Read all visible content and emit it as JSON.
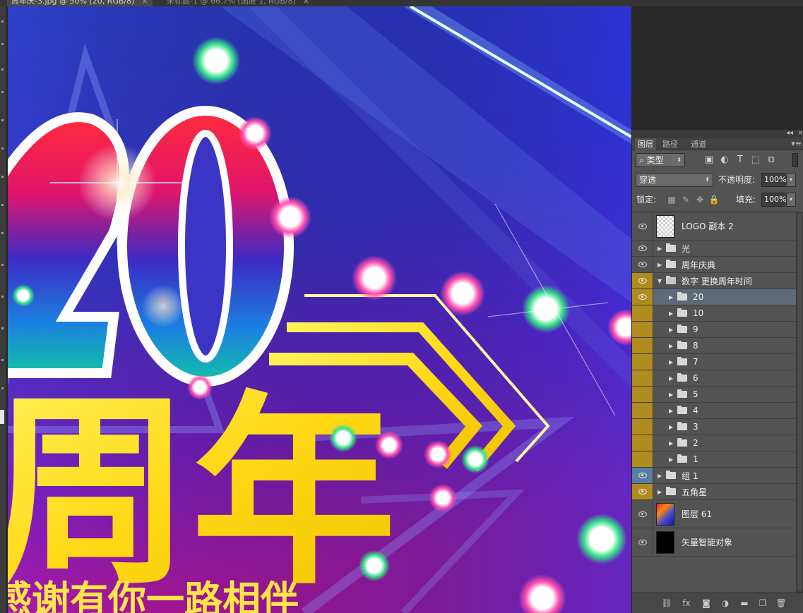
{
  "document_tabs": [
    {
      "label": "周年庆-3.jpg @ 50% (20, RGB/8)",
      "close": "×"
    },
    {
      "label": "未标题-1 @ 66.7% (图层 1, RGB/8)",
      "close": "×"
    }
  ],
  "canvas": {
    "big_number": "20",
    "headline": "周年",
    "subline": "感谢有你一路相伴"
  },
  "panel": {
    "collapse_glyph": "◂◂",
    "close_glyph": "×",
    "tabs": [
      "图层",
      "路径",
      "通道"
    ],
    "menu_glyph": "▾≡",
    "filter": {
      "kind_label": "类型",
      "search_glyph": "⌕"
    },
    "blend_mode": "穿透",
    "opacity_label": "不透明度:",
    "opacity_value": "100%",
    "lock_label": "锁定:",
    "fill_label": "填充:",
    "fill_value": "100%"
  },
  "layers": [
    {
      "name": "LOGO 副本 2",
      "type": "layer",
      "thumb": "checker",
      "eye": "normal",
      "indent": 0
    },
    {
      "name": "光",
      "type": "group",
      "expanded": false,
      "eye": "normal",
      "indent": 0
    },
    {
      "name": "周年庆典",
      "type": "group",
      "expanded": false,
      "eye": "normal",
      "indent": 0
    },
    {
      "name": "数字 更换周年时间",
      "type": "group",
      "expanded": true,
      "eye": "yellow",
      "indent": 0
    },
    {
      "name": "20",
      "type": "group",
      "expanded": false,
      "eye": "yellow",
      "indent": 1,
      "selected": true
    },
    {
      "name": "10",
      "type": "group",
      "expanded": false,
      "eye": "yellow-hidden",
      "indent": 1
    },
    {
      "name": "9",
      "type": "group",
      "expanded": false,
      "eye": "yellow-hidden",
      "indent": 1
    },
    {
      "name": "8",
      "type": "group",
      "expanded": false,
      "eye": "yellow-hidden",
      "indent": 1
    },
    {
      "name": "7",
      "type": "group",
      "expanded": false,
      "eye": "yellow-hidden",
      "indent": 1
    },
    {
      "name": "6",
      "type": "group",
      "expanded": false,
      "eye": "yellow-hidden",
      "indent": 1
    },
    {
      "name": "5",
      "type": "group",
      "expanded": false,
      "eye": "yellow-hidden",
      "indent": 1
    },
    {
      "name": "4",
      "type": "group",
      "expanded": false,
      "eye": "yellow-hidden",
      "indent": 1
    },
    {
      "name": "3",
      "type": "group",
      "expanded": false,
      "eye": "yellow-hidden",
      "indent": 1
    },
    {
      "name": "2",
      "type": "group",
      "expanded": false,
      "eye": "yellow-hidden",
      "indent": 1
    },
    {
      "name": "1",
      "type": "group",
      "expanded": false,
      "eye": "yellow-hidden",
      "indent": 1
    },
    {
      "name": "组 1",
      "type": "group",
      "expanded": false,
      "eye": "blue",
      "indent": 0
    },
    {
      "name": "五角星",
      "type": "group",
      "expanded": false,
      "eye": "yellow",
      "indent": 0
    },
    {
      "name": "图层 61",
      "type": "layer",
      "thumb": "grad",
      "eye": "normal",
      "indent": 0
    },
    {
      "name": "矢量智能对象",
      "type": "layer",
      "thumb": "black",
      "eye": "normal",
      "indent": 0
    }
  ],
  "bottom_icons": [
    "link-icon",
    "fx-icon",
    "mask-icon",
    "adjustment-icon",
    "new-group-icon",
    "new-layer-icon",
    "trash-icon"
  ]
}
